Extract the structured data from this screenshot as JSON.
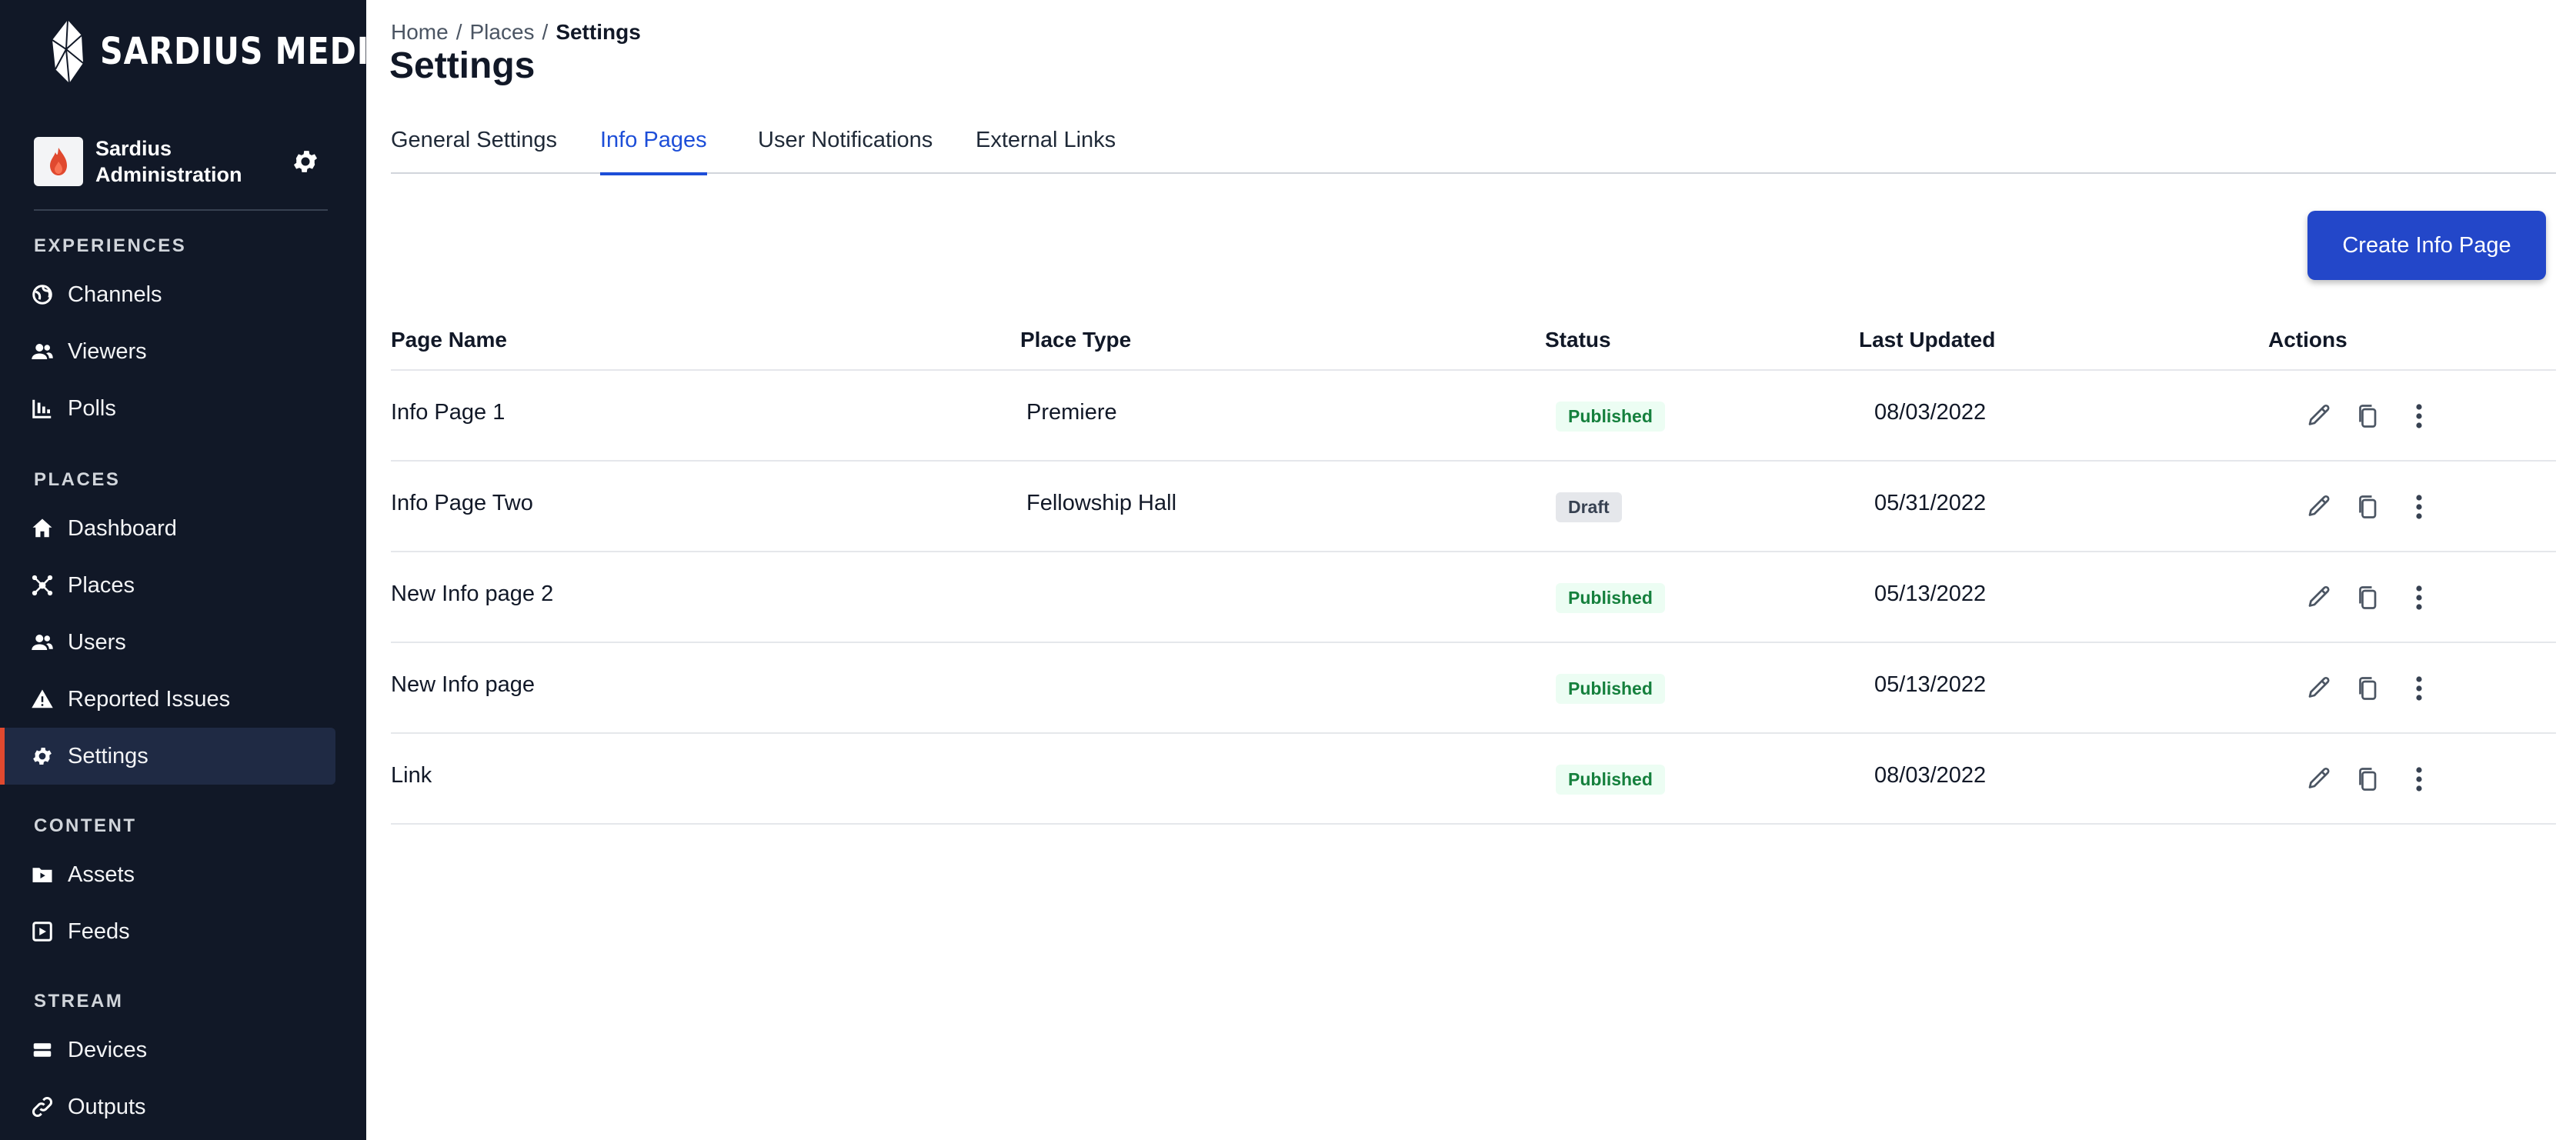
{
  "brand": {
    "name": "SARDIUS MEDIA",
    "registered": "®"
  },
  "org": {
    "line1": "Sardius",
    "line2": "Administration"
  },
  "sidebar": {
    "sections": [
      {
        "title": "EXPERIENCES",
        "items": [
          {
            "label": "Channels",
            "icon": "globe-icon"
          },
          {
            "label": "Viewers",
            "icon": "users-icon"
          },
          {
            "label": "Polls",
            "icon": "bar-chart-icon"
          }
        ]
      },
      {
        "title": "PLACES",
        "items": [
          {
            "label": "Dashboard",
            "icon": "home-icon"
          },
          {
            "label": "Places",
            "icon": "network-icon"
          },
          {
            "label": "Users",
            "icon": "users-icon"
          },
          {
            "label": "Reported Issues",
            "icon": "warning-icon"
          },
          {
            "label": "Settings",
            "icon": "gear-icon",
            "active": true
          }
        ]
      },
      {
        "title": "CONTENT",
        "items": [
          {
            "label": "Assets",
            "icon": "folder-video-icon"
          },
          {
            "label": "Feeds",
            "icon": "play-square-icon"
          }
        ]
      },
      {
        "title": "STREAM",
        "items": [
          {
            "label": "Devices",
            "icon": "server-icon"
          },
          {
            "label": "Outputs",
            "icon": "link-icon"
          }
        ]
      }
    ]
  },
  "breadcrumb": {
    "home": "Home",
    "places": "Places",
    "current": "Settings",
    "separator": "/"
  },
  "page": {
    "title": "Settings"
  },
  "tabs": [
    {
      "label": "General Settings"
    },
    {
      "label": "Info Pages",
      "active": true
    },
    {
      "label": "User Notifications"
    },
    {
      "label": "External Links"
    }
  ],
  "actions": {
    "create_label": "Create Info Page"
  },
  "table": {
    "headers": {
      "name": "Page Name",
      "place_type": "Place Type",
      "status": "Status",
      "updated": "Last Updated",
      "actions": "Actions"
    },
    "rows": [
      {
        "name": "Info Page 1",
        "place_type": "Premiere",
        "status": "Published",
        "updated": "08/03/2022"
      },
      {
        "name": "Info Page Two",
        "place_type": "Fellowship Hall",
        "status": "Draft",
        "updated": "05/31/2022"
      },
      {
        "name": "New Info page 2",
        "place_type": "",
        "status": "Published",
        "updated": "05/13/2022"
      },
      {
        "name": "New Info page",
        "place_type": "",
        "status": "Published",
        "updated": "05/13/2022"
      },
      {
        "name": "Link",
        "place_type": "",
        "status": "Published",
        "updated": "08/03/2022"
      }
    ]
  },
  "colors": {
    "sidebar_bg": "#111827",
    "accent_active": "#e0492f",
    "primary": "#2347c9",
    "tab_active": "#1d4ed8"
  }
}
